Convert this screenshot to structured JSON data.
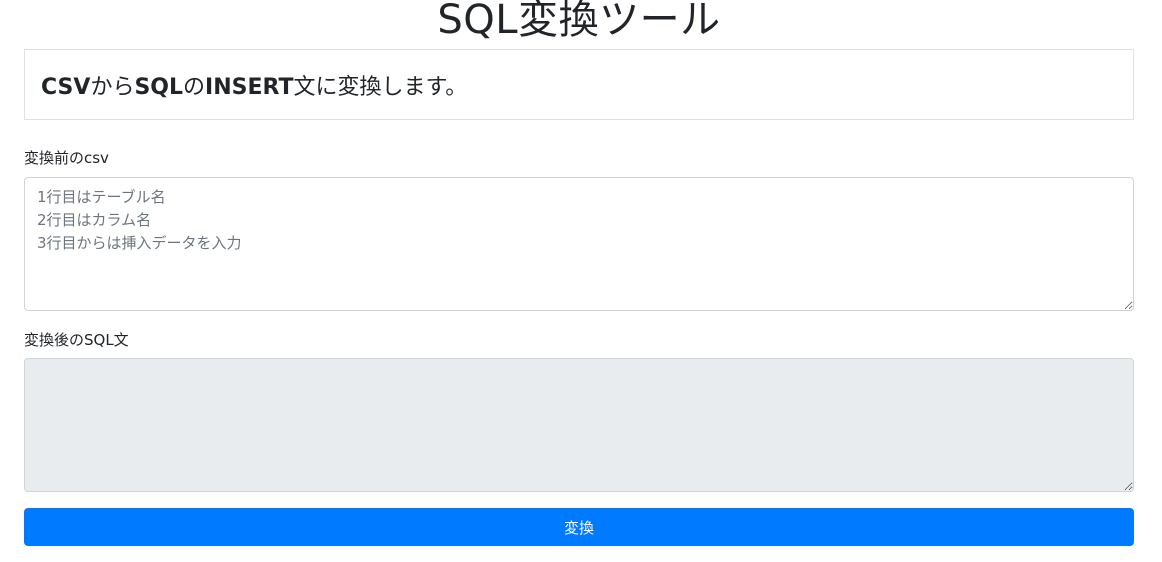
{
  "header": {
    "title": "SQL変換ツール"
  },
  "description": {
    "part1": "CSV",
    "part2": "から",
    "part3": "SQL",
    "part4": "の",
    "part5": "INSERT",
    "part6": "文に変換します。"
  },
  "form": {
    "csv_label": "変換前のcsv",
    "csv_value": "",
    "csv_placeholder": "1行目はテーブル名\n2行目はカラム名\n3行目からは挿入データを入力",
    "sql_label": "変換後のSQL文",
    "sql_value": "",
    "sql_readonly": true,
    "convert_label": "変換"
  },
  "colors": {
    "primary": "#007bff",
    "readonly_bg": "#e9ecef",
    "border": "#ced4da",
    "text": "#212529"
  }
}
